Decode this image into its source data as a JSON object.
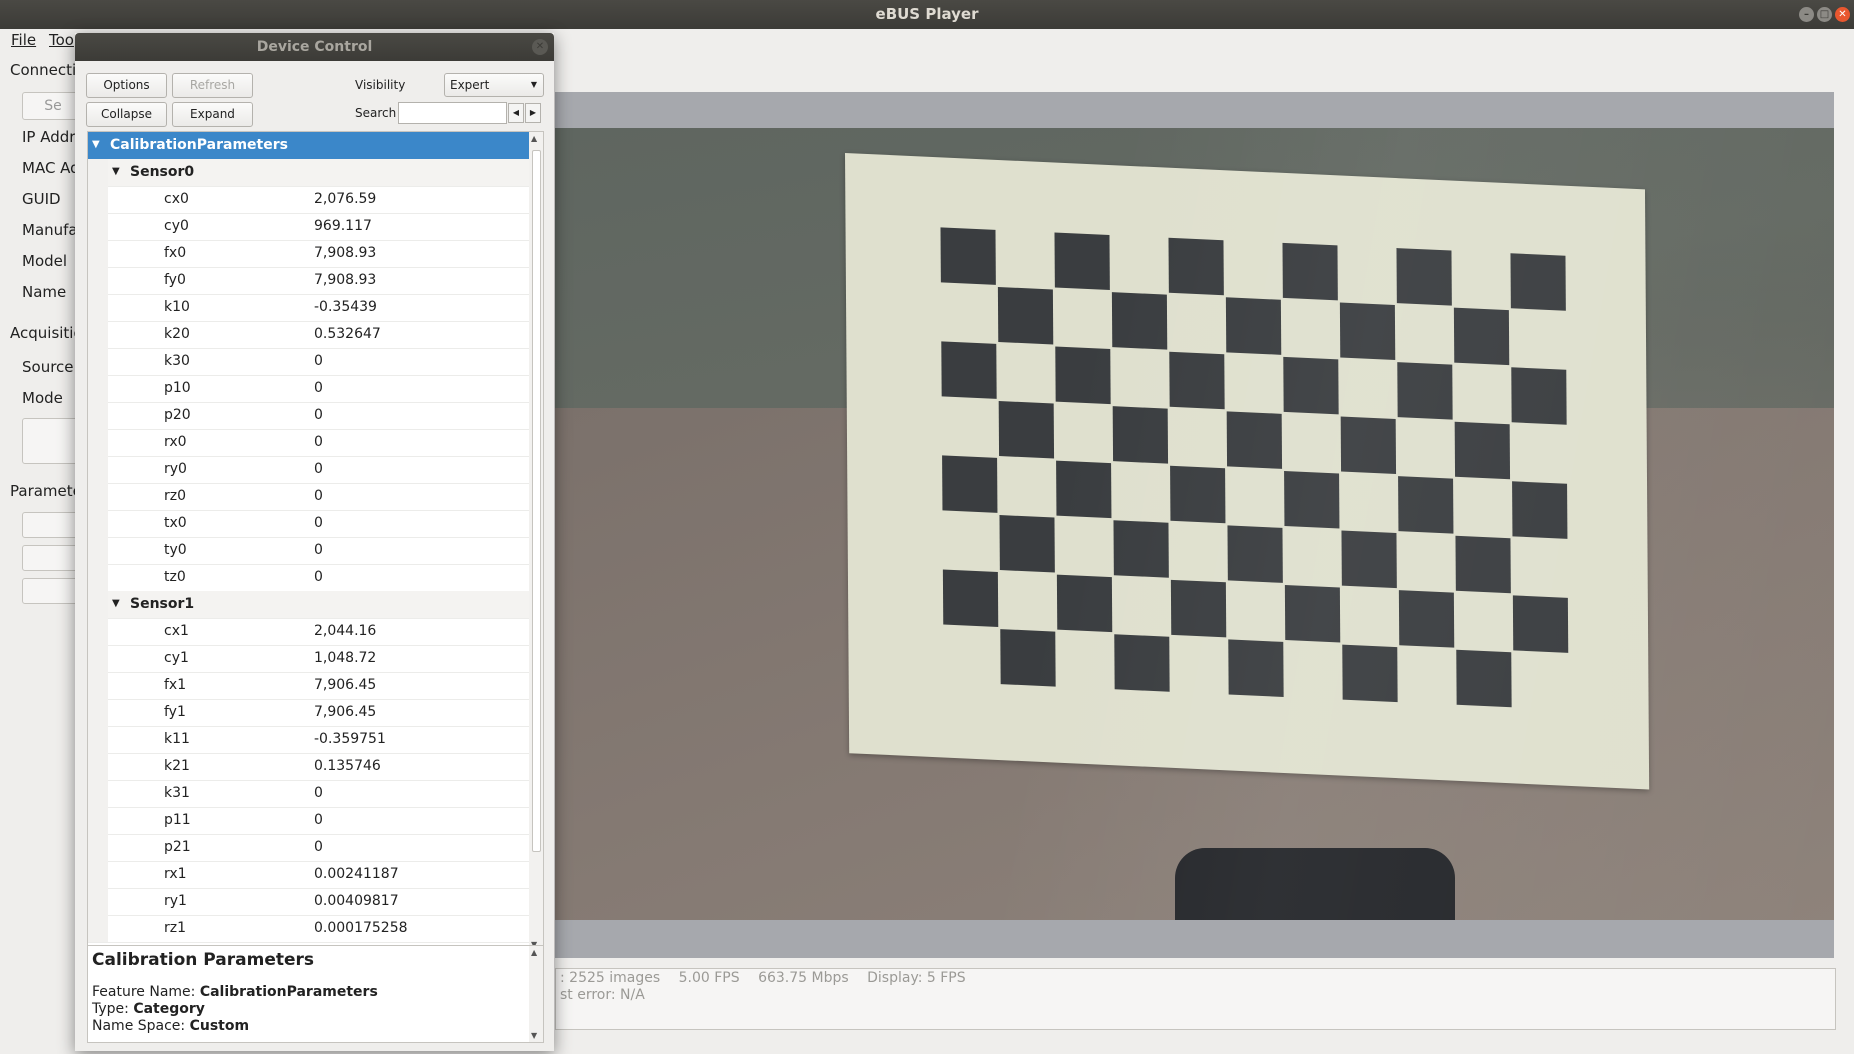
{
  "window": {
    "title": "eBUS Player"
  },
  "menu": {
    "file": "File",
    "tools": "Too"
  },
  "left_panel": {
    "connection": "Connectio",
    "select_btn": "Se",
    "fields": [
      "IP Addre",
      "MAC Ad",
      "GUID",
      "Manufa",
      "Model",
      "Name"
    ],
    "acquisition": "Acquisitio",
    "source": "Source",
    "mode": "Mode",
    "parameters": "Paramete"
  },
  "status": {
    "line1": [
      ": 2525 images",
      "5.00 FPS",
      "663.75 Mbps",
      "Display: 5 FPS"
    ],
    "line2": "st error: N/A"
  },
  "dialog": {
    "title": "Device Control",
    "options_label": "Options",
    "refresh_label": "Refresh",
    "collapse_label": "Collapse",
    "expand_label": "Expand",
    "visibility_label": "Visibility",
    "visibility_value": "Expert",
    "search_label": "Search",
    "search_value": "",
    "tree": {
      "root": "CalibrationParameters",
      "sensor0": {
        "name": "Sensor0",
        "params": [
          {
            "name": "cx0",
            "value": "2,076.59"
          },
          {
            "name": "cy0",
            "value": "969.117"
          },
          {
            "name": "fx0",
            "value": "7,908.93"
          },
          {
            "name": "fy0",
            "value": "7,908.93"
          },
          {
            "name": "k10",
            "value": "-0.35439"
          },
          {
            "name": "k20",
            "value": "0.532647"
          },
          {
            "name": "k30",
            "value": "0"
          },
          {
            "name": "p10",
            "value": "0"
          },
          {
            "name": "p20",
            "value": "0"
          },
          {
            "name": "rx0",
            "value": "0"
          },
          {
            "name": "ry0",
            "value": "0"
          },
          {
            "name": "rz0",
            "value": "0"
          },
          {
            "name": "tx0",
            "value": "0"
          },
          {
            "name": "ty0",
            "value": "0"
          },
          {
            "name": "tz0",
            "value": "0"
          }
        ]
      },
      "sensor1": {
        "name": "Sensor1",
        "params": [
          {
            "name": "cx1",
            "value": "2,044.16"
          },
          {
            "name": "cy1",
            "value": "1,048.72"
          },
          {
            "name": "fx1",
            "value": "7,906.45"
          },
          {
            "name": "fy1",
            "value": "7,906.45"
          },
          {
            "name": "k11",
            "value": "-0.359751"
          },
          {
            "name": "k21",
            "value": "0.135746"
          },
          {
            "name": "k31",
            "value": "0"
          },
          {
            "name": "p11",
            "value": "0"
          },
          {
            "name": "p21",
            "value": "0"
          },
          {
            "name": "rx1",
            "value": "0.00241187"
          },
          {
            "name": "ry1",
            "value": "0.00409817"
          },
          {
            "name": "rz1",
            "value": "0.000175258"
          }
        ]
      }
    },
    "description": {
      "title": "Calibration Parameters",
      "feature_name_label": "Feature Name:",
      "feature_name": "CalibrationParameters",
      "type_label": "Type:",
      "type": "Category",
      "namespace_label": "Name Space:",
      "namespace": "Custom"
    }
  }
}
